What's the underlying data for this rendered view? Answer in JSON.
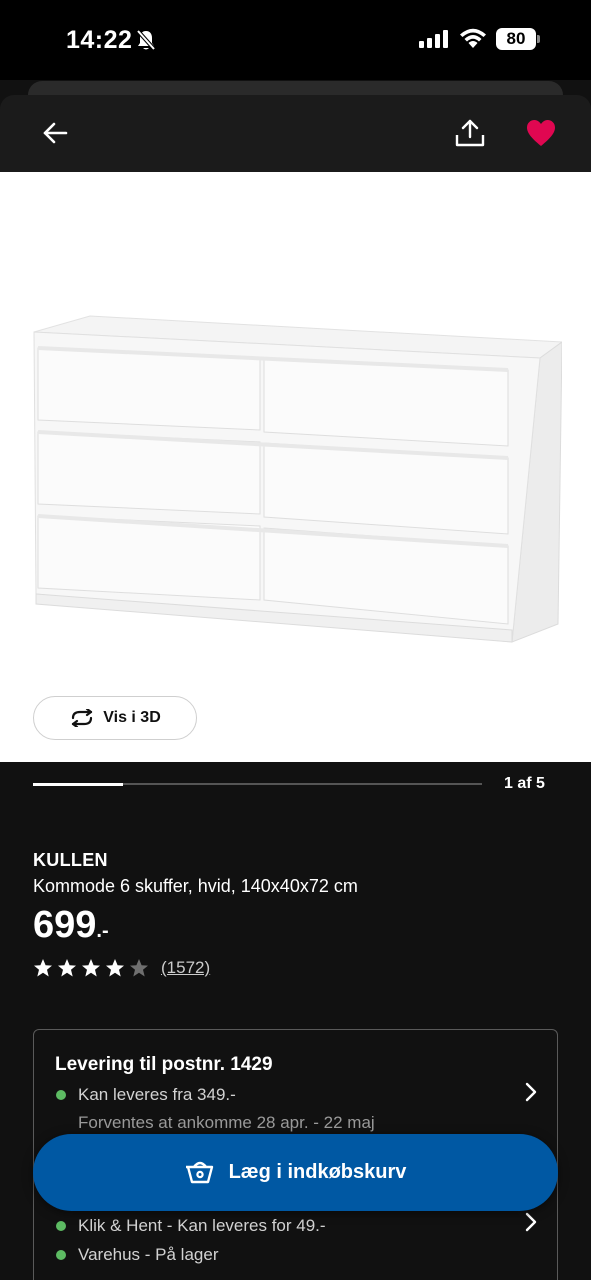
{
  "status_bar": {
    "time": "14:22",
    "battery": "80"
  },
  "header": {
    "back": "back-arrow-icon",
    "share": "share-icon",
    "favourite": "heart-icon"
  },
  "product_image": {
    "view_3d_label": "Vis i 3D"
  },
  "carousel": {
    "position_label": "1 af 5",
    "current": 1,
    "total": 5
  },
  "product": {
    "brand": "KULLEN",
    "description": "Kommode 6 skuffer, hvid, 140x40x72 cm",
    "price": "699",
    "price_suffix": ".-",
    "rating_stars": 4,
    "rating_max": 5,
    "review_count": "(1572)"
  },
  "delivery": {
    "title": "Levering til postnr. 1429",
    "home_delivery": "Kan leveres fra 349.-",
    "expected": "Forventes at ankomme 28 apr. - 22 maj",
    "click_collect": "Klik & Hent - Kan leveres for 49.-",
    "store_stock": "Varehus - På lager"
  },
  "cta": {
    "add_to_cart_label": "Læg i indkøbskurv"
  },
  "colors": {
    "accent": "#0058a3",
    "favourite": "#e00751",
    "in_stock": "#5dbb63",
    "background": "#111111"
  }
}
